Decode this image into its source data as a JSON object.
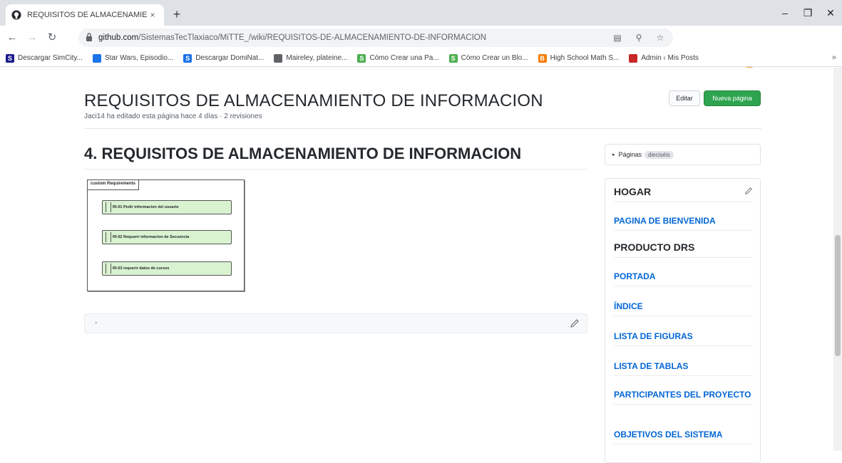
{
  "browser": {
    "tab_title": "REQUISITOS DE ALMACENAMIEN",
    "tab_close": "×",
    "new_tab": "+",
    "url_host": "github.com",
    "url_path": "/SistemasTecTlaxiaco/MiTTE_/wiki/REQUISITOS-DE-ALMACENAMIENTO-DE-INFORMACION",
    "bookmarks": [
      {
        "label": "Descargar SimCity...",
        "icon_color": "#1a1a8c",
        "icon_text": "S"
      },
      {
        "label": "Star Wars, Episodio...",
        "icon_color": "#1a73e8",
        "icon_text": ""
      },
      {
        "label": "Descargar DomiNat...",
        "icon_color": "#1a73e8",
        "icon_text": "S"
      },
      {
        "label": "Maireley, plateine...",
        "icon_color": "#5f6368",
        "icon_text": ""
      },
      {
        "label": "Cómo Crear una Pa...",
        "icon_color": "#4caf50",
        "icon_text": "S"
      },
      {
        "label": "Cómo Crear un Blo...",
        "icon_color": "#4caf50",
        "icon_text": "S"
      },
      {
        "label": "High School Math S...",
        "icon_color": "#f57c00",
        "icon_text": "B"
      },
      {
        "label": "Admin ‹ Mis Posts",
        "icon_color": "#c62828",
        "icon_text": ""
      }
    ],
    "bookmarks_more": "»"
  },
  "wiki": {
    "title": "REQUISITOS DE ALMACENAMIENTO DE INFORMACION",
    "meta": "Jaci14 ha editado esta página hace 4 días · 2 revisiones",
    "edit_label": "Editar",
    "new_page_label": "Nueva página"
  },
  "content": {
    "heading": "4. REQUISITOS DE ALMACENAMIENTO DE INFORMACION",
    "diagram": {
      "tab_label": "custom Requirements",
      "requirements": [
        "RI-01 Pedir informacion del usuario",
        "RI-02 Requerir informacion de Secuencia",
        "RI-03 requerir datos de cursos"
      ]
    },
    "footer_text": "-"
  },
  "sidebar": {
    "pages_label": "Páginas",
    "pages_count": "dieciséis",
    "items": [
      {
        "label": "HOGAR",
        "type": "head"
      },
      {
        "label": "PAGINA DE BIENVENIDA",
        "type": "link"
      },
      {
        "label": "PRODUCTO DRS",
        "type": "head"
      },
      {
        "label": "PORTADA",
        "type": "link"
      },
      {
        "label": "ÍNDICE",
        "type": "link"
      },
      {
        "label": "LISTA DE FIGURAS",
        "type": "link"
      },
      {
        "label": "LISTA DE TABLAS",
        "type": "link"
      },
      {
        "label": "PARTICIPANTES DEL PROYECTO",
        "type": "link"
      },
      {
        "label": "OBJETIVOS DEL SISTEMA",
        "type": "link"
      }
    ]
  },
  "colors": {
    "link": "#0366d6",
    "primary_button": "#2ea44f",
    "requirement_fill": "#d9f2d0"
  }
}
